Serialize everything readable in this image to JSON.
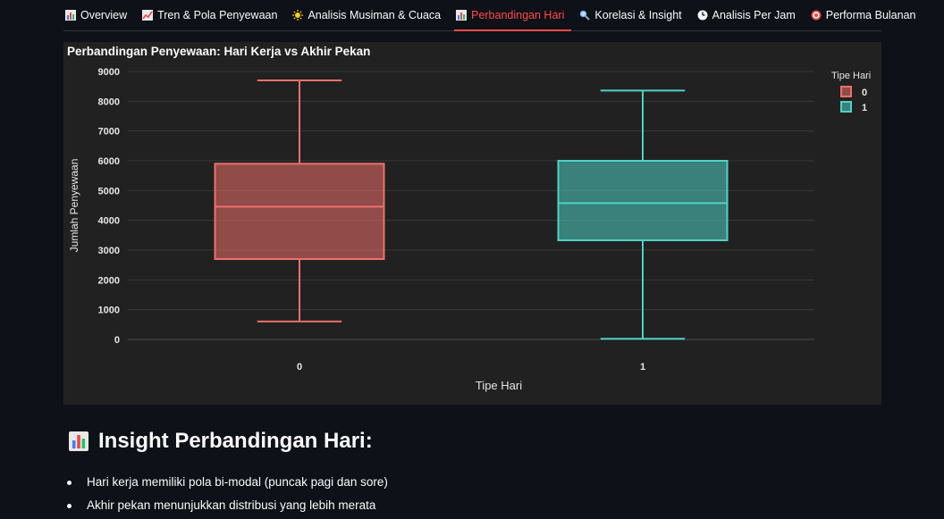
{
  "tabs": [
    {
      "label": "Overview",
      "icon": "bar-chart-icon",
      "active": false
    },
    {
      "label": "Tren & Pola Penyewaan",
      "icon": "trend-chart-icon",
      "active": false
    },
    {
      "label": "Analisis Musiman & Cuaca",
      "icon": "sun-icon",
      "active": false
    },
    {
      "label": "Perbandingan Hari",
      "icon": "bar-chart-icon",
      "active": true
    },
    {
      "label": "Korelasi & Insight",
      "icon": "magnifier-icon",
      "active": false
    },
    {
      "label": "Analisis Per Jam",
      "icon": "clock-icon",
      "active": false
    },
    {
      "label": "Performa Bulanan",
      "icon": "target-icon",
      "active": false
    }
  ],
  "colors": {
    "accent": "#ff4b4b",
    "series0": "#ef6f6c",
    "series1": "#4fd1c5"
  },
  "chart_data": {
    "type": "box",
    "title": "Perbandingan Penyewaan: Hari Kerja vs Akhir Pekan",
    "xlabel": "Tipe Hari",
    "ylabel": "Jumlah Penyewaan",
    "ylim": [
      0,
      9000
    ],
    "yticks": [
      0,
      1000,
      2000,
      3000,
      4000,
      5000,
      6000,
      7000,
      8000,
      9000
    ],
    "categories": [
      "0",
      "1"
    ],
    "legend": {
      "title": "Tipe Hari",
      "placement": "top-right",
      "entries": [
        "0",
        "1"
      ]
    },
    "series": [
      {
        "name": "0",
        "min": 605,
        "q1": 2700,
        "median": 4460,
        "q3": 5900,
        "max": 8700
      },
      {
        "name": "1",
        "min": 22,
        "q1": 3330,
        "median": 4580,
        "q3": 6000,
        "max": 8360
      }
    ],
    "grid": true
  },
  "insight": {
    "icon": "bar-chart-icon",
    "title": "Insight Perbandingan Hari:",
    "points": [
      "Hari kerja memiliki pola bi-modal (puncak pagi dan sore)",
      "Akhir pekan menunjukkan distribusi yang lebih merata"
    ]
  }
}
